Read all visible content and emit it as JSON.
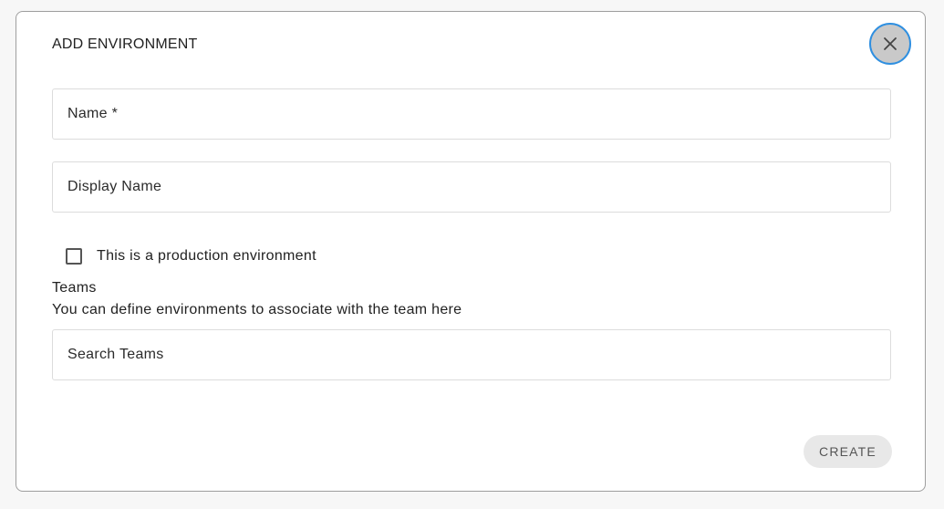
{
  "dialog": {
    "title": "ADD ENVIRONMENT",
    "close_icon": "close-icon"
  },
  "form": {
    "name_placeholder": "Name *",
    "display_name_placeholder": "Display Name",
    "production_label": "This is a production environment",
    "production_checked": false,
    "teams_title": "Teams",
    "teams_description": "You can define environments to associate with the team here",
    "teams_search_placeholder": "Search Teams"
  },
  "actions": {
    "create_label": "CREATE"
  },
  "colors": {
    "focus_ring": "#2f8fe0",
    "close_bg": "#c9c9c9",
    "create_bg": "#e8e8e8"
  }
}
